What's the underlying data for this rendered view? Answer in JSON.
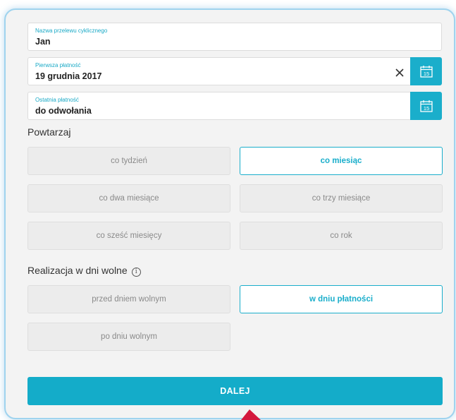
{
  "fields": {
    "name": {
      "label": "Nazwa przelewu cyklicznego",
      "value": "Jan"
    },
    "first_payment": {
      "label": "Pierwsza płatność",
      "value": "19 grudnia 2017",
      "calendar_icon_text": "15"
    },
    "last_payment": {
      "label": "Ostatnia płatność",
      "value": "do odwołania",
      "calendar_icon_text": "15"
    }
  },
  "repeat": {
    "title": "Powtarzaj",
    "options": [
      "co tydzień",
      "co miesiąc",
      "co dwa miesiące",
      "co trzy miesiące",
      "co sześć miesięcy",
      "co rok"
    ],
    "selected": "co miesiąc"
  },
  "holidays": {
    "title": "Realizacja w dni wolne",
    "info_icon": "i",
    "options": [
      "przed dniem wolnym",
      "w dniu płatności",
      "po dniu wolnym"
    ],
    "selected": "w dniu płatności"
  },
  "next_button": "DALEJ",
  "colors": {
    "accent": "#1aaecb",
    "frame_border": "#9fd3ee",
    "arrow": "#d4183d"
  }
}
